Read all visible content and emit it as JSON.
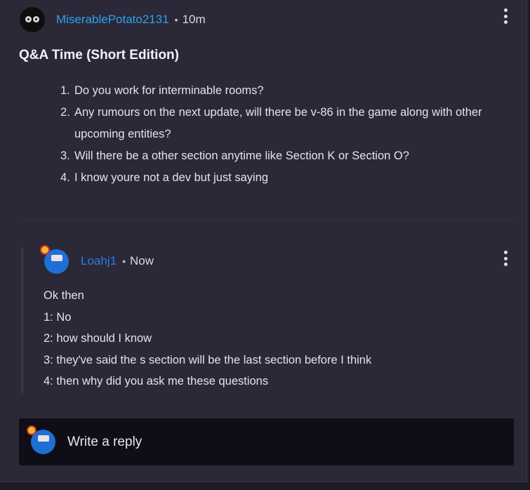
{
  "post": {
    "username": "MiserablePotato2131",
    "separator": "•",
    "time": "10m",
    "title": "Q&A Time (Short Edition)",
    "questions": [
      {
        "num": "1.",
        "text": "Do you work for interminable rooms?"
      },
      {
        "num": "2.",
        "text": "Any rumours on the next update, will there be v-86 in the game along with other upcoming entities?"
      },
      {
        "num": "3.",
        "text": "Will there be a other section anytime like Section K or Section O?"
      },
      {
        "num": "4.",
        "text": "I know youre not a dev but just saying"
      }
    ]
  },
  "reply": {
    "username": "Loahj1",
    "separator": "•",
    "time": "Now",
    "lines": [
      "Ok then",
      "1: No",
      "2: how should I know",
      "3: they've said the s section will be the last section before I think",
      "4: then why did you ask me these questions"
    ]
  },
  "composer": {
    "placeholder": "Write a reply"
  },
  "icons": {
    "post_menu": "more-vertical-icon",
    "reply_menu": "more-vertical-icon"
  },
  "colors": {
    "card_bg": "#2b2838",
    "username_blue": "#2aa3f0",
    "input_bg": "#0f0e16"
  }
}
